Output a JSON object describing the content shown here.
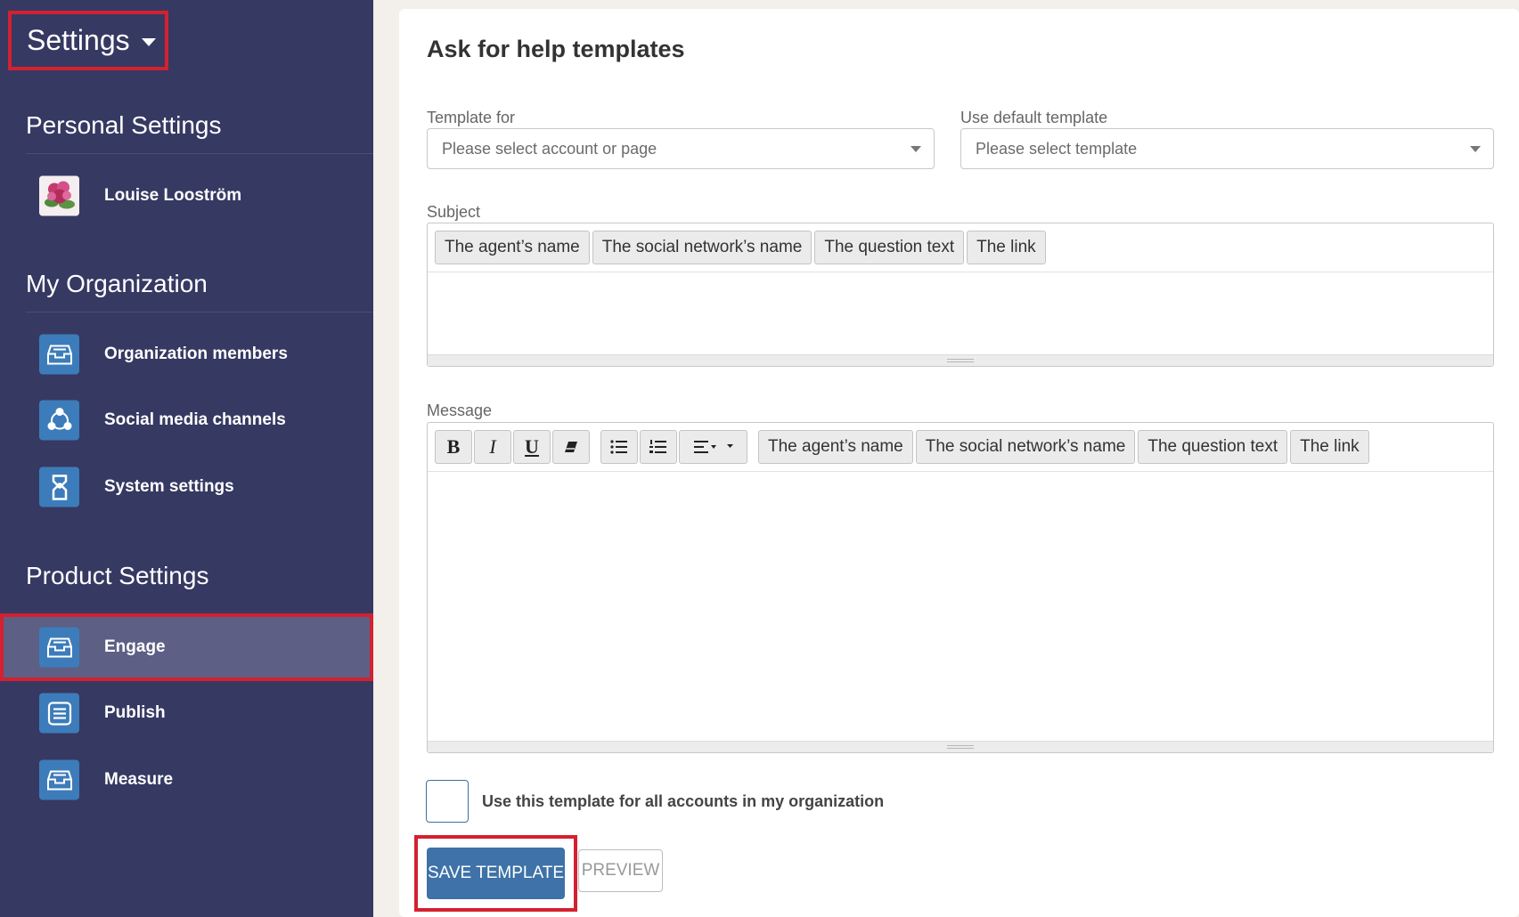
{
  "sidebar": {
    "title": "Settings",
    "sections": {
      "personal": "Personal Settings",
      "organization": "My Organization",
      "product": "Product Settings"
    },
    "user": {
      "name": "Louise Looström"
    },
    "org_items": [
      {
        "label": "Organization members",
        "icon": "inbox-icon"
      },
      {
        "label": "Social media channels",
        "icon": "network-icon"
      },
      {
        "label": "System settings",
        "icon": "robot-icon"
      }
    ],
    "product_items": [
      {
        "label": "Engage",
        "icon": "inbox-icon",
        "active": true
      },
      {
        "label": "Publish",
        "icon": "document-icon",
        "active": false
      },
      {
        "label": "Measure",
        "icon": "inbox-icon",
        "active": false
      }
    ]
  },
  "main": {
    "title": "Ask for help templates",
    "template_for": {
      "label": "Template for",
      "placeholder": "Please select account or page"
    },
    "default_template": {
      "label": "Use default template",
      "placeholder": "Please select template"
    },
    "subject": {
      "label": "Subject",
      "tokens": [
        "The agent’s name",
        "The social network’s name",
        "The question text",
        "The link"
      ]
    },
    "message": {
      "label": "Message",
      "tokens": [
        "The agent’s name",
        "The social network’s name",
        "The question text",
        "The link"
      ],
      "format_buttons": {
        "bold": "B",
        "italic": "I",
        "underline": "U"
      }
    },
    "use_for_all_label": "Use this template for all accounts in my organization",
    "save_label": "SAVE TEMPLATE",
    "preview_label": "PREVIEW"
  },
  "colors": {
    "sidebar_bg": "#363962",
    "icon_bg": "#3d7cba",
    "highlight": "#d42030",
    "primary_button": "#3e72a8"
  }
}
